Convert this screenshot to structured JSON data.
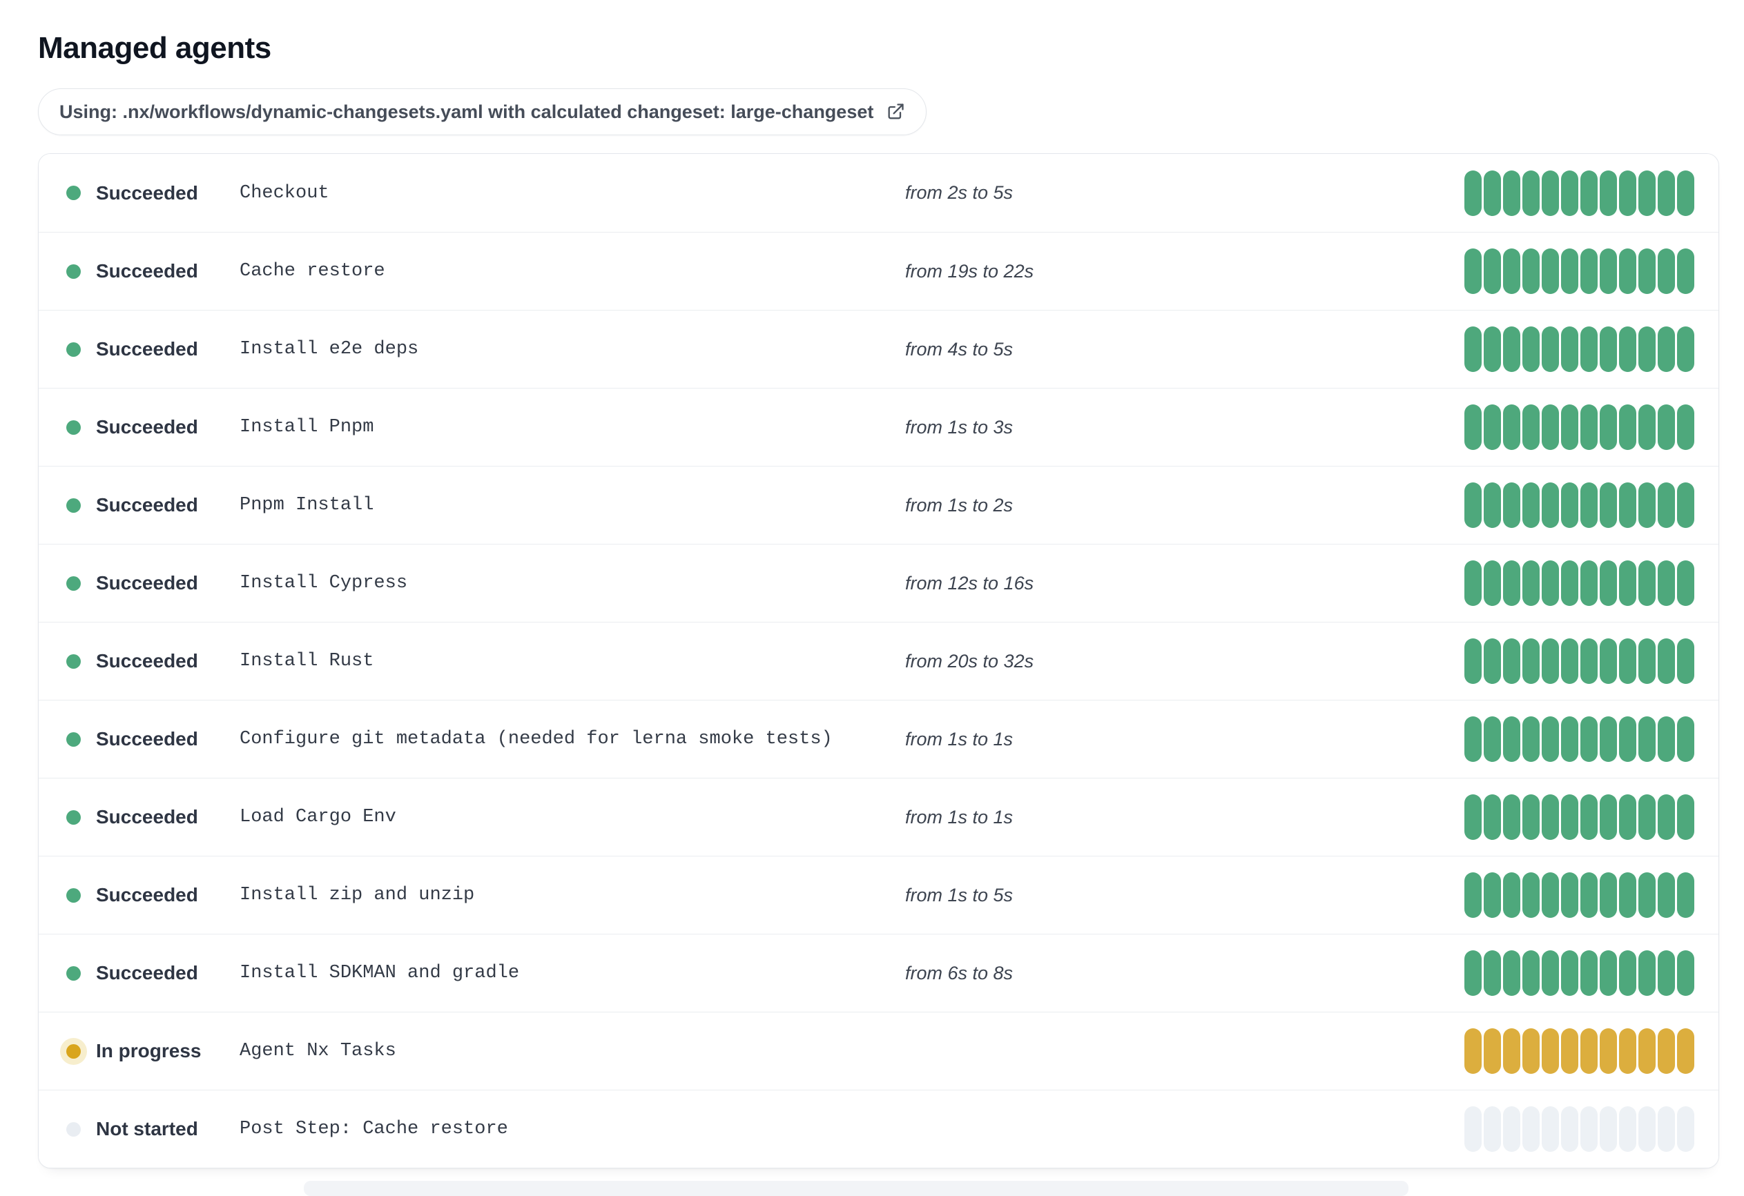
{
  "page": {
    "title": "Managed agents"
  },
  "workflow_banner": {
    "text": "Using: .nx/workflows/dynamic-changesets.yaml with calculated changeset: large-changeset",
    "icon": "external-link-icon"
  },
  "colors": {
    "succeeded_dot": "#4da97d",
    "succeeded_bar": "#4ea87c",
    "in_progress_dot": "#d9a51c",
    "in_progress_halo": "#f7eecd",
    "in_progress_bar": "#dcae3e",
    "not_started_dot": "#e9edf2",
    "not_started_bar": "#edf1f5"
  },
  "agents": {
    "bar_count": 12,
    "rows": [
      {
        "status": "succeeded",
        "status_label": "Succeeded",
        "name": "Checkout",
        "duration": "from 2s to 5s"
      },
      {
        "status": "succeeded",
        "status_label": "Succeeded",
        "name": "Cache restore",
        "duration": "from 19s to 22s"
      },
      {
        "status": "succeeded",
        "status_label": "Succeeded",
        "name": "Install e2e deps",
        "duration": "from 4s to 5s"
      },
      {
        "status": "succeeded",
        "status_label": "Succeeded",
        "name": "Install Pnpm",
        "duration": "from 1s to 3s"
      },
      {
        "status": "succeeded",
        "status_label": "Succeeded",
        "name": "Pnpm Install",
        "duration": "from 1s to 2s"
      },
      {
        "status": "succeeded",
        "status_label": "Succeeded",
        "name": "Install Cypress",
        "duration": "from 12s to 16s"
      },
      {
        "status": "succeeded",
        "status_label": "Succeeded",
        "name": "Install Rust",
        "duration": "from 20s to 32s"
      },
      {
        "status": "succeeded",
        "status_label": "Succeeded",
        "name": "Configure git metadata (needed for lerna smoke tests)",
        "duration": "from 1s to 1s"
      },
      {
        "status": "succeeded",
        "status_label": "Succeeded",
        "name": "Load Cargo Env",
        "duration": "from 1s to 1s"
      },
      {
        "status": "succeeded",
        "status_label": "Succeeded",
        "name": "Install zip and unzip",
        "duration": "from 1s to 5s"
      },
      {
        "status": "succeeded",
        "status_label": "Succeeded",
        "name": "Install SDKMAN and gradle",
        "duration": "from 6s to 8s"
      },
      {
        "status": "in-progress",
        "status_label": "In progress",
        "name": "Agent Nx Tasks",
        "duration": ""
      },
      {
        "status": "not-started",
        "status_label": "Not started",
        "name": "Post Step: Cache restore",
        "duration": ""
      }
    ]
  }
}
